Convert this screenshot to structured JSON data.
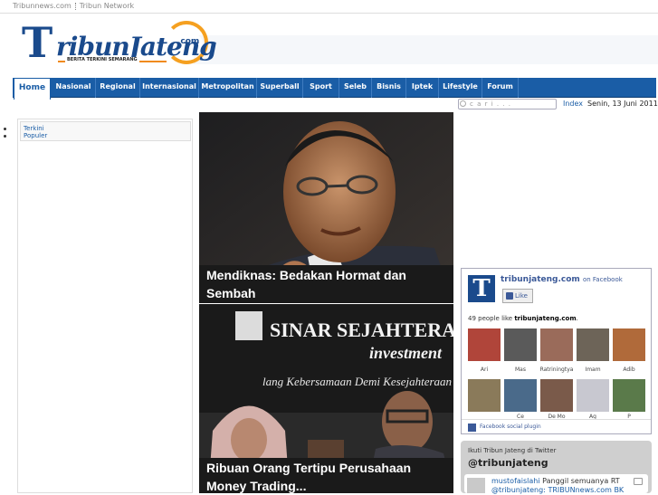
{
  "topbar": {
    "site": "Tribunnews.com",
    "network": "Tribun Network"
  },
  "logo": {
    "t": "T",
    "name": "ribunJateng",
    "com": ".com",
    "tagline": "BERITA TERKINI SEMARANG"
  },
  "nav": {
    "home": "Home",
    "items": [
      "Nasional",
      "Regional",
      "Internasional",
      "Metropolitan",
      "Superball",
      "Sport",
      "Seleb",
      "Bisnis",
      "Iptek",
      "Lifestyle",
      "Forum"
    ]
  },
  "search": {
    "placeholder": "c a r i . . ."
  },
  "index_link": "Index",
  "date": "Senin, 13 Juni 2011",
  "sidebar": {
    "tabs": [
      "Terkini",
      "Populer"
    ]
  },
  "stories": [
    {
      "caption": "Mendiknas: Bedakan Hormat dan Sembah"
    },
    {
      "caption": "Ribuan Orang Tertipu Perusahaan Money Trading..."
    }
  ],
  "sign": {
    "line1": "SINAR SEJAHTERA",
    "line2": "investment",
    "line3": "lang Kebersamaan Demi Kesejahteraan"
  },
  "facebook": {
    "page_name": "tribunjateng.com",
    "on_facebook": "on Facebook",
    "like_label": "Like",
    "count_text": "49 people like",
    "count_page": "tribunjateng.com",
    "fans": [
      "Ari",
      "Mas",
      "Ratriningtya",
      "Imam",
      "Adib"
    ],
    "fans_row2": [
      "",
      "Ce",
      "De Mo",
      "Ag",
      "P"
    ],
    "plugin_label": "Facebook social plugin",
    "fan_colors": [
      "#b0453a",
      "#5a5a5a",
      "#9a6b5a",
      "#6d6458",
      "#b06a3a",
      "#8a7a5a",
      "#4a6a8a",
      "#7a5a4a",
      "#c8c8d0",
      "#5a7a4a"
    ]
  },
  "twitter": {
    "header": "Ikuti Tribun Jateng di Twitter",
    "handle": "@tribunjateng",
    "tweet_user": "mustofaislahi",
    "tweet_text": "Panggil semuanya RT",
    "tweet_text2": "@tribunjateng: TRIBUNnews.com BK"
  }
}
